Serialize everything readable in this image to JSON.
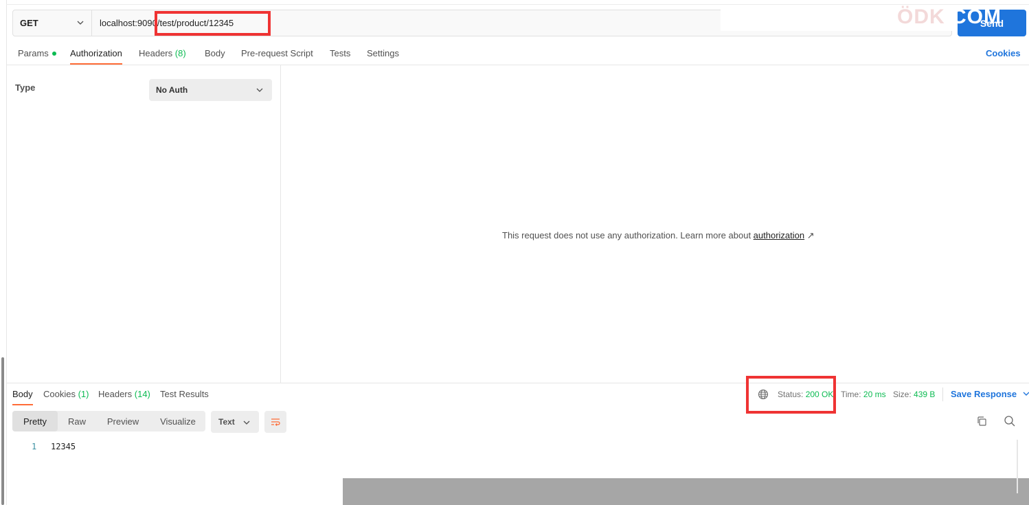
{
  "request": {
    "method": "GET",
    "url": "localhost:9090/test/product/12345",
    "send_label": "Send"
  },
  "watermark": {
    "pale": "ÖDK",
    "strong": ".COM"
  },
  "request_tabs": {
    "params": "Params",
    "authorization": "Authorization",
    "headers": "Headers",
    "headers_count": "(8)",
    "body": "Body",
    "prerequest": "Pre-request Script",
    "tests": "Tests",
    "settings": "Settings",
    "cookies": "Cookies"
  },
  "auth": {
    "type_label": "Type",
    "type_value": "No Auth",
    "message": "This request does not use any authorization. Learn more about ",
    "link_text": "authorization",
    "link_arrow": "↗"
  },
  "response_tabs": {
    "body": "Body",
    "cookies": "Cookies",
    "cookies_count": "(1)",
    "headers": "Headers",
    "headers_count": "(14)",
    "test_results": "Test Results"
  },
  "response_meta": {
    "status_label": "Status:",
    "status_value": "200 OK",
    "time_label": "Time:",
    "time_value": "20 ms",
    "size_label": "Size:",
    "size_value": "439 B",
    "save_label": "Save Response"
  },
  "view_modes": {
    "pretty": "Pretty",
    "raw": "Raw",
    "preview": "Preview",
    "visualize": "Visualize",
    "format": "Text"
  },
  "response_body": [
    {
      "line": "1",
      "text": "12345"
    }
  ],
  "colors": {
    "accent": "#1f75dc",
    "tab_underline": "#ff6c37",
    "success": "#0cbb52",
    "highlight_box": "#ef3333"
  }
}
